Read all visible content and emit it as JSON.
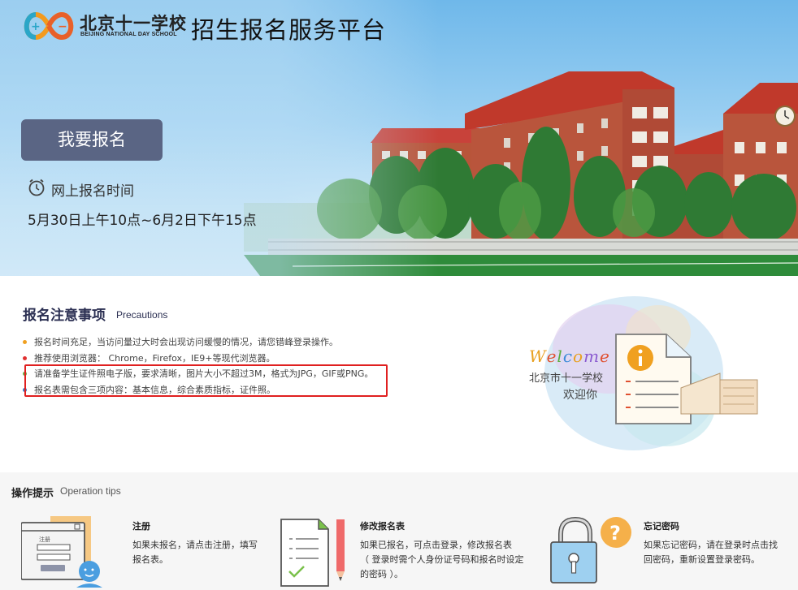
{
  "header": {
    "logo_text": "北京十一学校",
    "logo_subtext": "BEIJING NATIONAL DAY SCHOOL",
    "site_title": "招生报名服务平台"
  },
  "hero": {
    "register_button": "我要报名",
    "time_label": "网上报名时间",
    "time_value": "5月30日上午10点~6月2日下午15点"
  },
  "precautions": {
    "title": "报名注意事项",
    "subtitle": "Precautions",
    "items": [
      {
        "text": "报名时间充足，当访问量过大时会出现访问缓慢的情况，请您错峰登录操作。",
        "color": "#f0a020"
      },
      {
        "text": "推荐使用浏览器：  Chrome，Firefox，IE9+等现代浏览器。",
        "color": "#e03030"
      },
      {
        "text": "请准备学生证件照电子版，要求清晰，图片大小不超过3M，格式为JPG，GIF或PNG。",
        "color": "#6ab04c"
      },
      {
        "text": "报名表需包含三项内容：基本信息，综合素质指标，证件照。",
        "color": "#3a78c8"
      }
    ]
  },
  "welcome": {
    "word": "Welcome",
    "letter_colors": [
      "#e8a020",
      "#e05030",
      "#5ab040",
      "#3a8ad8",
      "#e8a020",
      "#8a5ad0",
      "#e05030"
    ],
    "school": "北京市十一学校",
    "greeting": "欢迎你"
  },
  "tips": {
    "title": "操作提示",
    "subtitle": "Operation tips",
    "items": [
      {
        "heading": "注册",
        "lines": [
          "如果未报名，请点击注册，填写",
          "报名表。"
        ]
      },
      {
        "heading": "修改报名表",
        "lines": [
          "如果已报名，可点击登录，修改报名表",
          "（ 登录时需个人身份证号码和报名时设定",
          "的密码 ）。"
        ]
      },
      {
        "heading": "忘记密码",
        "lines": [
          "如果忘记密码，请在登录时点击找",
          "回密码，重新设置登录密码。"
        ]
      }
    ],
    "register_card_label": "注册"
  }
}
